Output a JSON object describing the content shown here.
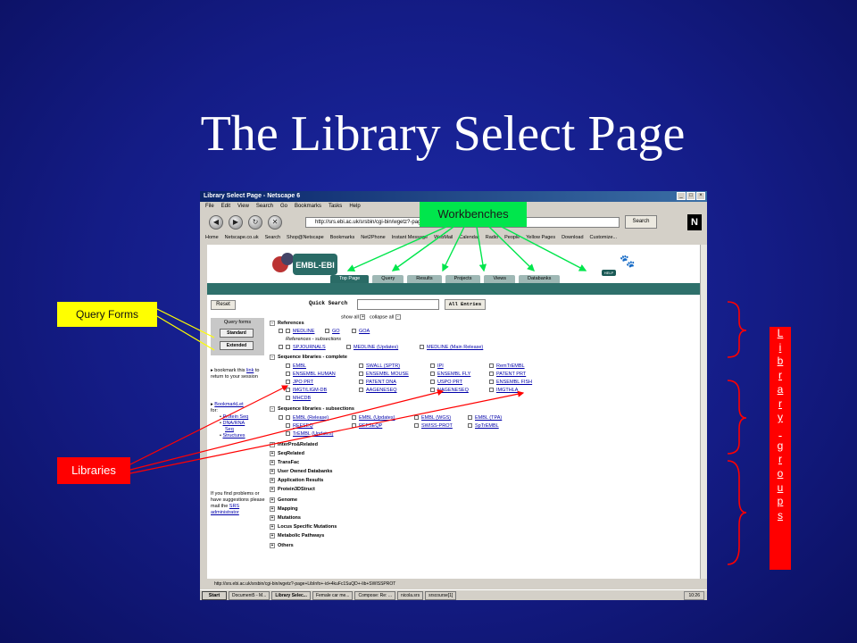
{
  "slide": {
    "title": "The Library Select Page"
  },
  "callouts": {
    "workbenches": "Workbenches",
    "query_forms": "Query Forms",
    "libraries": "Libraries",
    "library_groups": [
      "L",
      "i",
      "b",
      "r",
      "a",
      "r",
      "y",
      "",
      "g",
      "r",
      "o",
      "u",
      "p",
      "s"
    ]
  },
  "browser": {
    "title": "Library Select Page - Netscape 6",
    "menu": [
      "File",
      "Edit",
      "View",
      "Search",
      "Go",
      "Bookmarks",
      "Tasks",
      "Help"
    ],
    "url": "http://srs.ebi.ac.uk/srsbin/cgi-bin/wgetz?-page+",
    "search_label": "Search",
    "bookmarks": [
      "Home",
      "Netscape.co.uk",
      "Search",
      "Shop@Netscape",
      "Bookmarks",
      "Net2Phone",
      "Instant Message",
      "WebMail",
      "Calendar",
      "Radio",
      "People",
      "Yellow Pages",
      "Download",
      "Customize..."
    ],
    "status_url": "http://srs.ebi.ac.uk/srsbin/cgi-bin/wgetz?-page+LibInfo+-id+4kuFc1SuQD+-lib+SWISSPROT"
  },
  "page": {
    "logo_text": "SRS EMBL-EBI",
    "help": "HELP",
    "tabs": [
      "Top Page",
      "Query",
      "Results",
      "Projects",
      "Views",
      "Databanks"
    ],
    "reset": "Reset",
    "quick_search": "Quick Search",
    "all_entries": "All Entries",
    "show_all": "show all",
    "collapse_all": "collapse all",
    "query_forms_title": "Query forms",
    "standard": "Standard",
    "extended": "Extended",
    "bookmark_text_1": "bookmark this",
    "bookmark_link": "link",
    "bookmark_text_2": "to return to your session",
    "bookmarklet": "BookmarkLet",
    "bookmarklet_for": "for:",
    "protein_seq": "Protein Seq",
    "dna_rna": "DNA/RNA",
    "seq": "Seq",
    "structures": "Structures",
    "problems_1": "If you find problems or have suggestions please mail the",
    "srs_admin": "SRS administrator",
    "references": "References",
    "ref_items": [
      "MEDLINE",
      "GO",
      "GOA"
    ],
    "ref_sub": "References - subsections",
    "ref_sub_items": [
      "SPJOURNALS",
      "MEDLINE (Updates)",
      "MEDLINE (Main Release)"
    ],
    "seq_complete": "Sequence libraries - complete",
    "seq_items": [
      [
        "EMBL",
        "SWALL (SPTR)",
        "IPI",
        "RemTrEMBL"
      ],
      [
        "ENSEMBL HUMAN",
        "ENSEMBL MOUSE",
        "ENSEMBL FLY",
        "PATENT PRT"
      ],
      [
        "JPO PRT",
        "PATENT DNA",
        "USPO PRT",
        "ENSEMBL FISH"
      ],
      [
        "IMGT/LIGM-DB",
        "AAGENESEQ",
        "NAGENESEQ",
        "IMGTHLA"
      ],
      [
        "MHCDB",
        "",
        "",
        ""
      ]
    ],
    "seq_sub": "Sequence libraries - subsections",
    "seq_sub_items": [
      [
        "EMBL (Release)",
        "EMBL (Updates)",
        "EMBL (WGS)",
        "EMBL (TPA)"
      ],
      [
        "REFSEQ",
        "REFSEQP",
        "SWISS-PROT",
        "SpTrEMBL"
      ],
      [
        "TrEMBL (Updates)",
        "",
        "",
        ""
      ]
    ],
    "groups": [
      "InterPro&Related",
      "SeqRelated",
      "TransFac",
      "User Owned Databanks",
      "Application Results",
      "Protein3DStruct",
      "Genome",
      "Mapping",
      "Mutations",
      "Locus Specific Mutations",
      "Metabolic Pathways",
      "Others"
    ]
  },
  "taskbar": {
    "start": "Start",
    "items": [
      "Document5 - M...",
      "Library Selec...",
      "Female car me...",
      "Compose: Re: ...",
      "nicola.srs",
      "srscourse[1]"
    ],
    "clock": "10:26"
  },
  "colors": {
    "bg": "#141c86",
    "teal": "#2e706b",
    "workbench_arrow": "#00e64c",
    "query_line": "#ffff00",
    "library_line": "#ff0000",
    "bracket": "#ff0000"
  }
}
